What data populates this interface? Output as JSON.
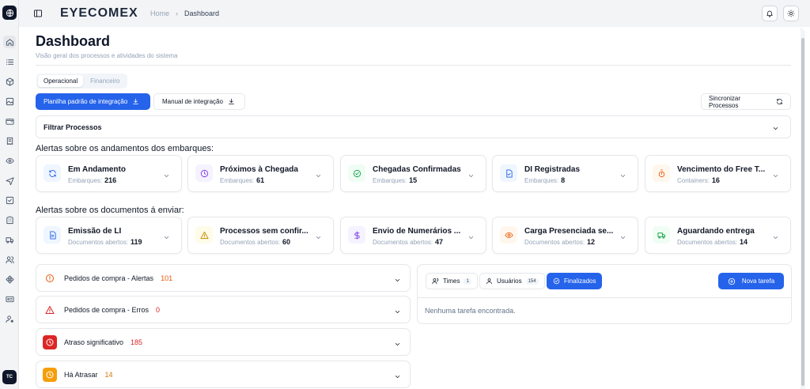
{
  "app": {
    "brand": "EYECOMEX",
    "avatar": "TC"
  },
  "breadcrumb": {
    "home": "Home",
    "separator": "›",
    "current": "Dashboard"
  },
  "sidebar": {
    "icons": [
      "home-icon",
      "list-icon",
      "box-icon",
      "image-icon",
      "wallet-icon",
      "receipt-icon",
      "eye-icon",
      "plane-icon",
      "check-square-icon",
      "building-icon",
      "truck-icon",
      "users-icon",
      "network-icon",
      "id-card-icon",
      "user-cog-icon"
    ]
  },
  "page": {
    "title": "Dashboard",
    "subtitle": "Visão geral dos processos e atividades do sistema"
  },
  "tabs": [
    {
      "label": "Operacional",
      "active": true
    },
    {
      "label": "Financeiro",
      "active": false
    }
  ],
  "actions": {
    "template": "Planilha padrão de integração",
    "manual": "Manual de integração",
    "sync": "Sincronizar Processos"
  },
  "filter": {
    "label": "Filtrar Processos"
  },
  "shipment_alerts": {
    "heading": "Alertas sobre os andamentos dos embarques:",
    "cards": [
      {
        "title": "Em Andamento",
        "sub": "Embarques:",
        "value": "216",
        "icon": "refresh-icon",
        "color": "#2563eb",
        "bg": "#eff6ff"
      },
      {
        "title": "Próximos à Chegada",
        "sub": "Embarques:",
        "value": "61",
        "icon": "clock-icon",
        "color": "#7c3aed",
        "bg": "#f5f3ff"
      },
      {
        "title": "Chegadas Confirmadas",
        "sub": "Embarques:",
        "value": "15",
        "icon": "check-circle-icon",
        "color": "#16a34a",
        "bg": "#f0fdf4"
      },
      {
        "title": "DI Registradas",
        "sub": "Embarques:",
        "value": "8",
        "icon": "file-check-icon",
        "color": "#2563eb",
        "bg": "#eff6ff"
      },
      {
        "title": "Vencimento do Free T...",
        "sub": "Containers:",
        "value": "16",
        "icon": "timer-icon",
        "color": "#ea580c",
        "bg": "#fff7ed"
      }
    ]
  },
  "document_alerts": {
    "heading": "Alertas sobre os documentos á enviar:",
    "cards": [
      {
        "title": "Emissão de LI",
        "sub": "Documentos abertos:",
        "value": "119",
        "icon": "document-icon",
        "color": "#2563eb",
        "bg": "#eff6ff"
      },
      {
        "title": "Processos sem confir...",
        "sub": "Documentos abertos:",
        "value": "60",
        "icon": "warning-icon",
        "color": "#ca8a04",
        "bg": "#fefce8"
      },
      {
        "title": "Envio de Numerários ...",
        "sub": "Documentos abertos:",
        "value": "47",
        "icon": "dollar-icon",
        "color": "#7c3aed",
        "bg": "#f5f3ff"
      },
      {
        "title": "Carga Presenciada se...",
        "sub": "Documentos abertos:",
        "value": "12",
        "icon": "eye-icon",
        "color": "#ea580c",
        "bg": "#fff7ed"
      },
      {
        "title": "Aguardando entrega",
        "sub": "Documentos abertos:",
        "value": "14",
        "icon": "truck-icon",
        "color": "#16a34a",
        "bg": "#f0fdf4"
      }
    ]
  },
  "purchase_orders": [
    {
      "label": "Pedidos de compra - Alertas",
      "count": "101",
      "icon": "alert-circle-icon",
      "color": "#ea580c"
    },
    {
      "label": "Pedidos de compra - Erros",
      "count": "0",
      "icon": "alert-triangle-icon",
      "color": "#dc2626"
    },
    {
      "label": "Atraso significativo",
      "count": "185",
      "icon": "clock-filled-icon",
      "color": "#dc2626"
    },
    {
      "label": "Há Atrasar",
      "count": "14",
      "icon": "clock-filled-icon",
      "color": "#d97706"
    }
  ],
  "tasks": {
    "times": {
      "label": "Times",
      "count": "1"
    },
    "users": {
      "label": "Usuários",
      "count": "154"
    },
    "finished": {
      "label": "Finalizados"
    },
    "new_task": "Nova tarefa",
    "empty": "Nenhuma tarefa encontrada."
  }
}
